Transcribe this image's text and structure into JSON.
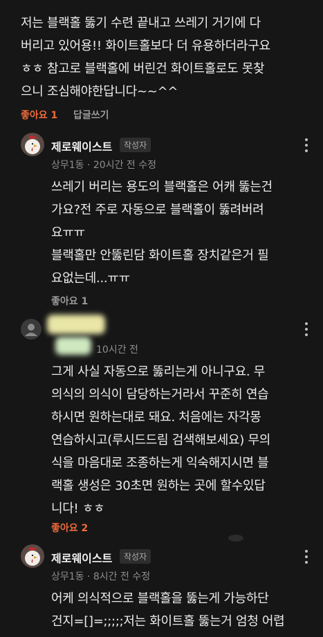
{
  "comment_top": {
    "lines": [
      "저는 블랙홀 뚫기 수련 끝내고 쓰레기 거기에 다",
      "버리고 있어용!! 화이트홀보다 더 유용하더라구요",
      "ㅎㅎ 참고로 블랙홀에 버린건 화이트홀로도 못찾",
      "으니 조심해야한답니다~~^^"
    ],
    "like_label": "좋아요 1",
    "reply_label": "답글쓰기"
  },
  "reply1": {
    "author": "제로웨이스트",
    "badge": "작성자",
    "meta": "상무1동 · 20시간 전 수정",
    "lines": [
      "쓰레기 버리는 용도의 블랙홀은 어캐 뚫는건",
      "가요?전 주로 자동으로 블랙홀이 뚫려버려",
      "요ㅠㅠ",
      "블랙홀만 안뚫린담 화이트홀 장치같은거 필",
      "요없는데...ㅠㅠ"
    ],
    "like_label": "좋아요 1"
  },
  "reply2": {
    "meta_time": "10시간 전",
    "lines": [
      "그게 사실 자동으로 뚫리는게 아니구요. 무",
      "의식의 의식이 담당하는거라서 꾸준히 연습",
      "하시면 원하는대로 돼요. 처음에는 자각몽",
      "연습하시고(루시드드림 검색해보세요) 무의",
      "식을 마음대로 조종하는게 익숙해지시면 블",
      "랙홀 생성은 30초면 원하는 곳에 할수있답",
      "니다! ㅎㅎ"
    ],
    "like_label": "좋아요 2"
  },
  "reply3": {
    "author": "제로웨이스트",
    "badge": "작성자",
    "meta": "상무1동 · 8시간 전 수정",
    "lines": [
      "어케 의식적으로 블랙홀을 뚫는게 가능하단",
      "건지=[]=;;;;;저는 화이트홀 뚫는거 엄청 어렵"
    ]
  },
  "colors": {
    "background": "#161616",
    "accent_like": "#f06a3a",
    "text_primary": "#ececec",
    "text_secondary": "#8e8e8e"
  }
}
